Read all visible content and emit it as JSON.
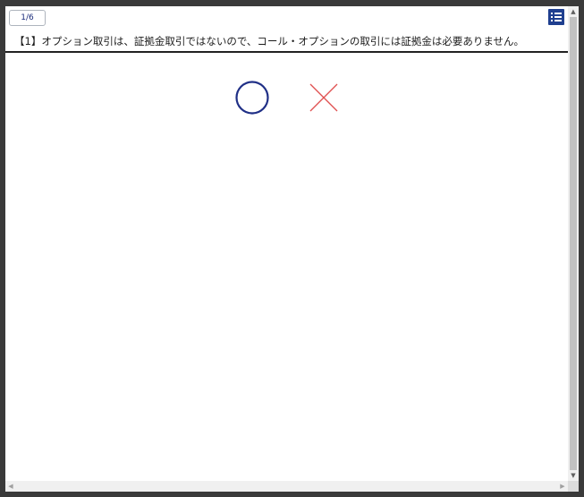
{
  "quiz": {
    "page_counter": "1/6",
    "question_text": "【1】オプション取引は、証拠金取引ではないので、コール・オプションの取引には証拠金は必要ありません。"
  },
  "answers": {
    "true_option": {
      "icon": "circle-icon",
      "color": "#1f2f86"
    },
    "false_option": {
      "icon": "cross-icon",
      "color": "#e05050"
    }
  },
  "icons": {
    "menu": "list-menu-icon",
    "scroll_up": "▲",
    "scroll_down": "▼",
    "scroll_left": "◀",
    "scroll_right": "▶"
  },
  "colors": {
    "accent": "#1f3f8f",
    "divider": "#222222",
    "circle": "#1f2f86",
    "cross": "#e05050"
  }
}
